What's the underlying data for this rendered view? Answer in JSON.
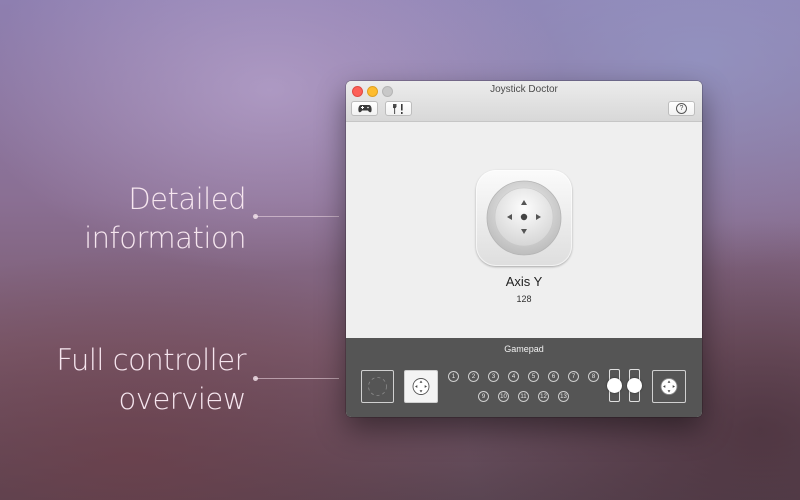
{
  "captions": {
    "detailed_line1": "Detailed",
    "detailed_line2": "information",
    "overview_line1": "Full controller",
    "overview_line2": "overview"
  },
  "window": {
    "title": "Joystick Doctor",
    "toolbar": {
      "left_buttons": [
        "gamepad-icon",
        "tools-icon"
      ],
      "right_button": "help-icon",
      "help_label": "?"
    }
  },
  "detail": {
    "icon": "dpad-icon",
    "label": "Axis Y",
    "value": "128"
  },
  "gamepad": {
    "title": "Gamepad",
    "buttons_row1": [
      "1",
      "2",
      "3",
      "4",
      "5",
      "6",
      "7",
      "8"
    ],
    "buttons_row2": [
      "9",
      "10",
      "11",
      "12",
      "13"
    ]
  }
}
